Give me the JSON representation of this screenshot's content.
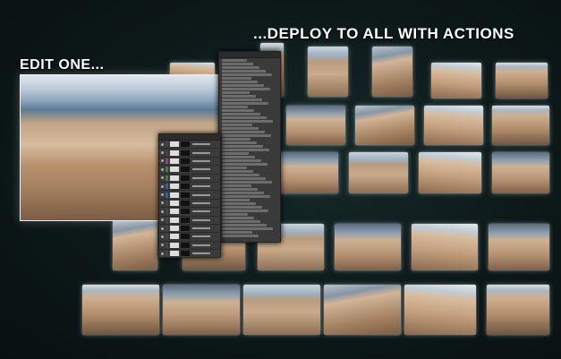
{
  "captions": {
    "deploy": "...DEPLOY TO ALL WITH ACTIONS",
    "edit": "EDIT ONE..."
  },
  "icons": [
    "eye-icon"
  ],
  "colors": {
    "background": "#0e1a1a",
    "text": "#ffffff",
    "panel": "#3a3a3a"
  }
}
